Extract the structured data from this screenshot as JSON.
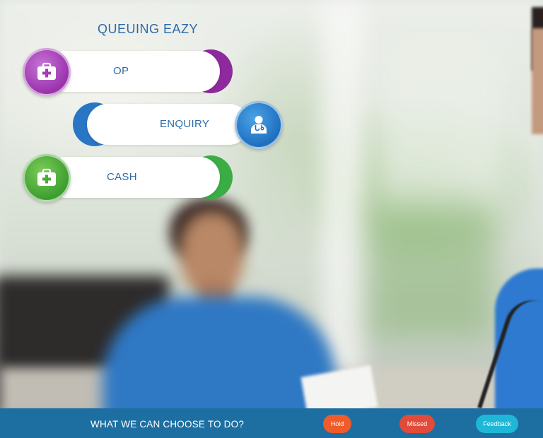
{
  "app": {
    "title": "QUEUING EAZY"
  },
  "menu": {
    "items": [
      {
        "label": "OP",
        "icon": "medical-kit-icon",
        "color": "#9b33ad"
      },
      {
        "label": "ENQUIRY",
        "icon": "doctor-icon",
        "color": "#2876c4"
      },
      {
        "label": "CASH",
        "icon": "medical-kit-icon",
        "color": "#3aae45"
      }
    ]
  },
  "bottom_bar": {
    "prompt": "WHAT WE CAN CHOOSE TO DO?",
    "color": "#1d6fa2",
    "buttons": [
      {
        "label": "Hold",
        "color": "#ef5b2a"
      },
      {
        "label": "Missed",
        "color": "#e24a39"
      },
      {
        "label": "Feedback",
        "color": "#1fb7d8"
      }
    ]
  }
}
